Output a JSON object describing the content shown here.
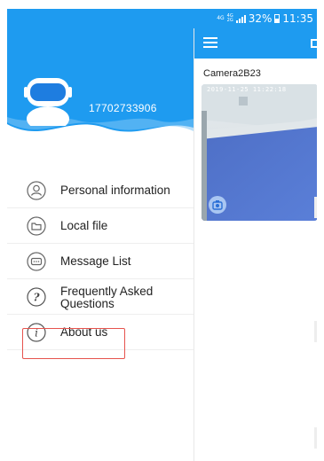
{
  "status_bar": {
    "network_top": "4G",
    "network_mid": "4G",
    "network_low": "2G",
    "battery": "32%",
    "time": "11:35"
  },
  "drawer": {
    "phone": "17702733906",
    "items": [
      {
        "label": "Personal information",
        "icon": "person-icon"
      },
      {
        "label": "Local file",
        "icon": "folder-icon"
      },
      {
        "label": "Message List",
        "icon": "message-icon"
      },
      {
        "label": "Frequently Asked Questions",
        "icon": "question-icon"
      },
      {
        "label": "About us",
        "icon": "info-icon"
      }
    ],
    "highlighted_item": "About us"
  },
  "main": {
    "camera_name": "Camera2B23",
    "timestamp": "2019-11-25 11:22:18"
  },
  "colors": {
    "primary": "#1e9bf0",
    "highlight_border": "#e6534d",
    "icon_gray": "#666666"
  }
}
